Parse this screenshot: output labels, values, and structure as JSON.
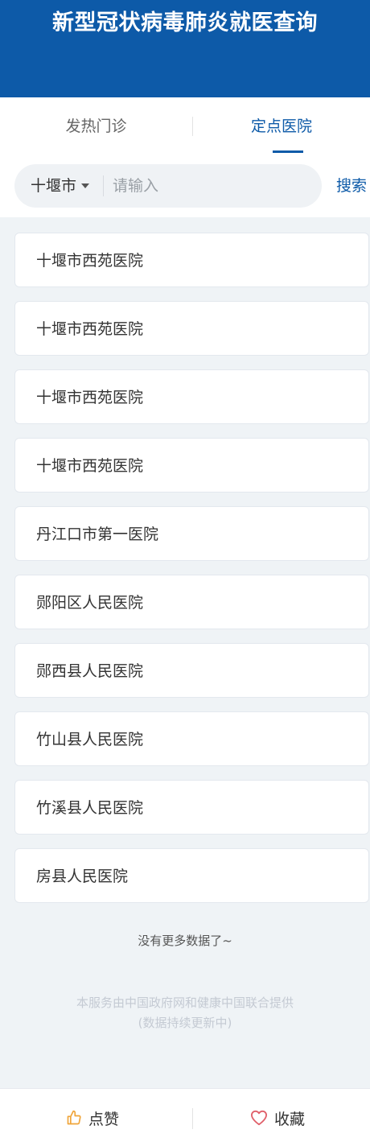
{
  "header": {
    "title": "新型冠状病毒肺炎就医查询"
  },
  "tabs": [
    {
      "label": "发热门诊",
      "active": false
    },
    {
      "label": "定点医院",
      "active": true
    }
  ],
  "search": {
    "city": "十堰市",
    "placeholder": "请输入",
    "value": "",
    "button_label": "搜索"
  },
  "hospitals": [
    "十堰市西苑医院",
    "十堰市西苑医院",
    "十堰市西苑医院",
    "十堰市西苑医院",
    "丹江口市第一医院",
    "郧阳区人民医院",
    "郧西县人民医院",
    "竹山县人民医院",
    "竹溪县人民医院",
    "房县人民医院"
  ],
  "list_end_text": "没有更多数据了~",
  "footer": {
    "line1": "本服务由中国政府网和健康中国联合提供",
    "line2": "(数据持续更新中)"
  },
  "bottom_bar": {
    "like_label": "点赞",
    "favorite_label": "收藏",
    "like_icon": "thumbs-up-icon",
    "favorite_icon": "heart-icon"
  },
  "colors": {
    "brand_blue": "#0d5aa8",
    "page_bg": "#eff3f6",
    "like_icon": "#f0a53a",
    "favorite_icon": "#e0606a"
  }
}
